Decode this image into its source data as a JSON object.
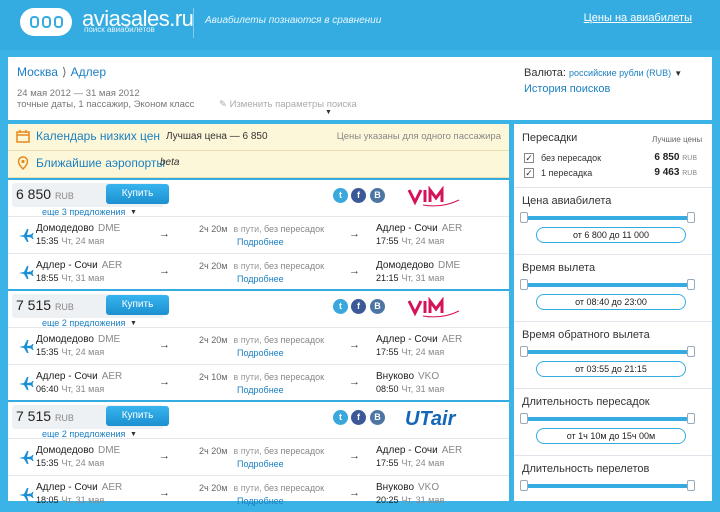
{
  "topbar": {
    "brand": "aviasales.ru",
    "brand_sub": "поиск авиабилетов",
    "slogan": "Авиабилеты познаются в сравнении",
    "link": "Цены на авиабилеты"
  },
  "search": {
    "from": "Москва",
    "to": "Адлер",
    "dates": "24 мая 2012 — 31 мая 2012",
    "params": "точные даты,  1 пассажир,  Эконом класс",
    "change": "Изменить параметры поиска",
    "currency_label": "Валюта:",
    "currency_value": "российские рубли (RUB)",
    "history": "История поисков"
  },
  "info": {
    "calendar": "Календарь низких цен",
    "best_price": "Лучшая цена — 6 850",
    "note": "Цены указаны для одного пассажира",
    "airports": "Ближайшие аэропорты",
    "beta": "beta"
  },
  "results": [
    {
      "price": "6 850",
      "currency": "RUB",
      "buy": "Купить",
      "more": "еще 3 предложения",
      "airline": "vim",
      "legs": [
        {
          "from": "Домодедово",
          "from_code": "DME",
          "dep": "15:35",
          "dep_date": "Чт, 24 мая",
          "dur": "2ч 20м",
          "in_path": "в пути,",
          "stops": "без пересадок",
          "details": "Подробнее",
          "to": "Адлер - Сочи",
          "to_code": "AER",
          "arr": "17:55",
          "arr_date": "Чт, 24 мая"
        },
        {
          "from": "Адлер - Сочи",
          "from_code": "AER",
          "dep": "18:55",
          "dep_date": "Чт, 31 мая",
          "dur": "2ч 20м",
          "in_path": "в пути,",
          "stops": "без пересадок",
          "details": "Подробнее",
          "to": "Домодедово",
          "to_code": "DME",
          "arr": "21:15",
          "arr_date": "Чт, 31 мая"
        }
      ]
    },
    {
      "price": "7 515",
      "currency": "RUB",
      "buy": "Купить",
      "more": "еще 2 предложения",
      "airline": "vim",
      "legs": [
        {
          "from": "Домодедово",
          "from_code": "DME",
          "dep": "15:35",
          "dep_date": "Чт, 24 мая",
          "dur": "2ч 20м",
          "in_path": "в пути,",
          "stops": "без пересадок",
          "details": "Подробнее",
          "to": "Адлер - Сочи",
          "to_code": "AER",
          "arr": "17:55",
          "arr_date": "Чт, 24 мая"
        },
        {
          "from": "Адлер - Сочи",
          "from_code": "AER",
          "dep": "06:40",
          "dep_date": "Чт, 31 мая",
          "dur": "2ч 10м",
          "in_path": "в пути,",
          "stops": "без пересадок",
          "details": "Подробнее",
          "to": "Внуково",
          "to_code": "VKO",
          "arr": "08:50",
          "arr_date": "Чт, 31 мая"
        }
      ]
    },
    {
      "price": "7 515",
      "currency": "RUB",
      "buy": "Купить",
      "more": "еще 2 предложения",
      "airline": "utair",
      "airline_text": "UTair",
      "legs": [
        {
          "from": "Домодедово",
          "from_code": "DME",
          "dep": "15:35",
          "dep_date": "Чт, 24 мая",
          "dur": "2ч 20м",
          "in_path": "в пути,",
          "stops": "без пересадок",
          "details": "Подробнее",
          "to": "Адлер - Сочи",
          "to_code": "AER",
          "arr": "17:55",
          "arr_date": "Чт, 24 мая"
        },
        {
          "from": "Адлер - Сочи",
          "from_code": "AER",
          "dep": "18:05",
          "dep_date": "Чт, 31 мая",
          "dur": "2ч 20м",
          "in_path": "в пути,",
          "stops": "без пересадок",
          "details": "Подробнее",
          "to": "Внуково",
          "to_code": "VKO",
          "arr": "20:25",
          "arr_date": "Чт, 31 мая"
        }
      ]
    }
  ],
  "filters": {
    "transfers": {
      "title": "Пересадки",
      "best_label": "Лучшие цены",
      "rows": [
        {
          "label": "без пересадок",
          "price": "6 850",
          "cur": "RUB"
        },
        {
          "label": "1 пересадка",
          "price": "9 463",
          "cur": "RUB"
        }
      ]
    },
    "sections": [
      {
        "title": "Цена авиабилета",
        "range": "от 6 800  до 11 000"
      },
      {
        "title": "Время вылета",
        "range": "от 08:40 до 23:00"
      },
      {
        "title": "Время обратного вылета",
        "range": "от 03:55 до 21:15"
      },
      {
        "title": "Длительность пересадок",
        "range": "от 1ч 10м до 15ч 00м"
      },
      {
        "title": "Длительность перелетов",
        "range": ""
      }
    ]
  },
  "colors": {
    "accent": "#35ace1",
    "link": "#1a7fc1",
    "vim_red": "#d4145a",
    "utair_blue": "#1466b8"
  }
}
